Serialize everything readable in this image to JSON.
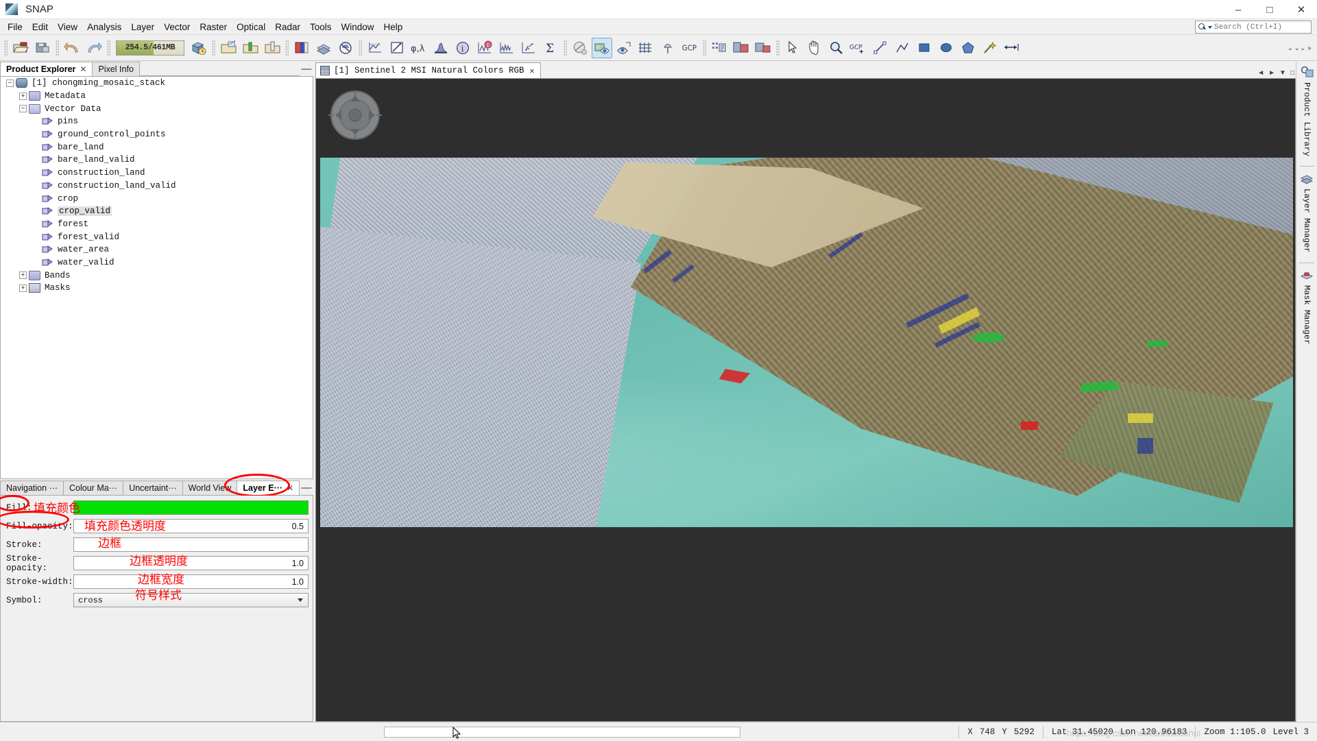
{
  "window": {
    "title": "SNAP",
    "app_icon": "snap-logo-icon",
    "minimize": "–",
    "maximize": "□",
    "close": "✕"
  },
  "menubar": {
    "items": [
      {
        "label": "File"
      },
      {
        "label": "Edit"
      },
      {
        "label": "View"
      },
      {
        "label": "Analysis"
      },
      {
        "label": "Layer"
      },
      {
        "label": "Vector"
      },
      {
        "label": "Raster"
      },
      {
        "label": "Optical"
      },
      {
        "label": "Radar"
      },
      {
        "label": "Tools"
      },
      {
        "label": "Window"
      },
      {
        "label": "Help"
      }
    ]
  },
  "search": {
    "placeholder": "Search (Ctrl+I)",
    "value": "",
    "icon": "search-icon"
  },
  "toolbar": {
    "memory_text": "254.5/461MB",
    "memory_percent": 55,
    "buttons": [
      {
        "name": "open-product-icon",
        "tooltip": "Open Product"
      },
      {
        "name": "save-product-icon",
        "tooltip": "Save Product"
      },
      {
        "name": "undo-icon",
        "tooltip": "Undo"
      },
      {
        "name": "redo-icon",
        "tooltip": "Redo"
      },
      {
        "name": "reset-memory-icon",
        "tooltip": "Reset Memory"
      },
      {
        "name": "open-rgb-image-icon",
        "tooltip": "Open RGB Image View"
      },
      {
        "name": "open-band-icon",
        "tooltip": "Open Image View"
      },
      {
        "name": "close-product-icon",
        "tooltip": "Close Product"
      },
      {
        "name": "colour-manipulation-icon",
        "tooltip": "Colour Manipulation"
      },
      {
        "name": "layer-manager-icon",
        "tooltip": "Layer Manager"
      },
      {
        "name": "mask-manager-icon",
        "tooltip": "Mask Manager"
      },
      {
        "name": "profile-plot-icon",
        "tooltip": "Profile Plot"
      },
      {
        "name": "geo-coding-icon",
        "tooltip": "Geo-Coding"
      },
      {
        "name": "phi-lambda-icon",
        "tooltip": "Geo-Coding Info"
      },
      {
        "name": "histogram-icon",
        "tooltip": "Histogram"
      },
      {
        "name": "information-icon",
        "tooltip": "Information"
      },
      {
        "name": "metadata-plot-icon",
        "tooltip": "Metadata Plot"
      },
      {
        "name": "spectrum-view-icon",
        "tooltip": "Optical Spectrum View"
      },
      {
        "name": "scatter-plot-icon",
        "tooltip": "Scatter Plot"
      },
      {
        "name": "statistics-icon",
        "tooltip": "Statistics"
      },
      {
        "name": "no-data-overlay-icon",
        "tooltip": "No-Data Overlay"
      },
      {
        "name": "mask-overlay-icon",
        "tooltip": "Mask Overlay"
      },
      {
        "name": "geometry-overlay-icon",
        "tooltip": "Geometry Overlay"
      },
      {
        "name": "graticule-overlay-icon",
        "tooltip": "Graticule Overlay"
      },
      {
        "name": "pin-overlay-icon",
        "tooltip": "Pin Overlay"
      },
      {
        "name": "gcp-overlay-icon",
        "tooltip": "GCP Overlay"
      },
      {
        "name": "pixel-info-icon",
        "tooltip": "Pixel Info"
      },
      {
        "name": "subset-icon",
        "tooltip": "Subset"
      },
      {
        "name": "band-maths-icon",
        "tooltip": "Band Maths"
      },
      {
        "name": "selection-tool-icon",
        "tooltip": "Selection"
      },
      {
        "name": "pan-tool-icon",
        "tooltip": "Panning"
      },
      {
        "name": "zoom-tool-icon",
        "tooltip": "Zooming"
      },
      {
        "name": "pin-tool-icon",
        "tooltip": "Pin placing"
      },
      {
        "name": "gcp-tool-icon",
        "tooltip": "GCP placing"
      },
      {
        "name": "line-tool-icon",
        "tooltip": "Line drawing"
      },
      {
        "name": "polyline-tool-icon",
        "tooltip": "Polyline drawing"
      },
      {
        "name": "rectangle-tool-icon",
        "tooltip": "Rectangle drawing"
      },
      {
        "name": "ellipse-tool-icon",
        "tooltip": "Ellipse drawing"
      },
      {
        "name": "polygon-tool-icon",
        "tooltip": "Polygon drawing"
      },
      {
        "name": "magic-wand-icon",
        "tooltip": "Magic Wand"
      },
      {
        "name": "range-finder-icon",
        "tooltip": "Range Finder"
      }
    ]
  },
  "left_panel": {
    "tabs": [
      {
        "label": "Product Explorer",
        "selected": true,
        "closable": true
      },
      {
        "label": "Pixel Info",
        "selected": false,
        "closable": false
      }
    ],
    "minimize_glyph": "—",
    "tree": [
      {
        "label": "[1] chongming_mosaic_stack",
        "indent": 0,
        "expander": "−",
        "icon": "product-icon",
        "selected": false
      },
      {
        "label": "Metadata",
        "indent": 1,
        "expander": "+",
        "icon": "folder-icon",
        "selected": false
      },
      {
        "label": "Vector Data",
        "indent": 1,
        "expander": "−",
        "icon": "folder-open-icon",
        "selected": false
      },
      {
        "label": "pins",
        "indent": 2,
        "expander": "",
        "icon": "vector-node-icon",
        "selected": false
      },
      {
        "label": "ground_control_points",
        "indent": 2,
        "expander": "",
        "icon": "vector-node-icon",
        "selected": false
      },
      {
        "label": "bare_land",
        "indent": 2,
        "expander": "",
        "icon": "vector-node-icon",
        "selected": false
      },
      {
        "label": "bare_land_valid",
        "indent": 2,
        "expander": "",
        "icon": "vector-node-icon",
        "selected": false
      },
      {
        "label": "construction_land",
        "indent": 2,
        "expander": "",
        "icon": "vector-node-icon",
        "selected": false
      },
      {
        "label": "construction_land_valid",
        "indent": 2,
        "expander": "",
        "icon": "vector-node-icon",
        "selected": false
      },
      {
        "label": "crop",
        "indent": 2,
        "expander": "",
        "icon": "vector-node-icon",
        "selected": false
      },
      {
        "label": "crop_valid",
        "indent": 2,
        "expander": "",
        "icon": "vector-node-icon",
        "selected": true
      },
      {
        "label": "forest",
        "indent": 2,
        "expander": "",
        "icon": "vector-node-icon",
        "selected": false
      },
      {
        "label": "forest_valid",
        "indent": 2,
        "expander": "",
        "icon": "vector-node-icon",
        "selected": false
      },
      {
        "label": "water_area",
        "indent": 2,
        "expander": "",
        "icon": "vector-node-icon",
        "selected": false
      },
      {
        "label": "water_valid",
        "indent": 2,
        "expander": "",
        "icon": "vector-node-icon",
        "selected": false
      },
      {
        "label": "Bands",
        "indent": 1,
        "expander": "+",
        "icon": "folder-icon",
        "selected": false
      },
      {
        "label": "Masks",
        "indent": 1,
        "expander": "+",
        "icon": "mask-folder-icon",
        "selected": false
      }
    ]
  },
  "bottom_panel": {
    "tabs": [
      {
        "label": "Navigation ···",
        "selected": false,
        "closable": false
      },
      {
        "label": "Colour Ma···",
        "selected": false,
        "closable": false
      },
      {
        "label": "Uncertaint···",
        "selected": false,
        "closable": false
      },
      {
        "label": "World View",
        "selected": false,
        "closable": false
      },
      {
        "label": "Layer E···",
        "selected": true,
        "closable": true
      }
    ],
    "minimize_glyph": "—",
    "layer_editor": {
      "fields": [
        {
          "label": "Fill:",
          "type": "color",
          "value": "",
          "color": "#00e000",
          "annotation": "填充颜色"
        },
        {
          "label": "Fill-opacity:",
          "type": "number",
          "value": "0.5",
          "annotation": "填充颜色透明度"
        },
        {
          "label": "Stroke:",
          "type": "color",
          "value": "",
          "annotation": "边框"
        },
        {
          "label": "Stroke-opacity:",
          "type": "number",
          "value": "1.0",
          "annotation": "边框透明度"
        },
        {
          "label": "Stroke-width:",
          "type": "number",
          "value": "1.0",
          "annotation": "边框宽度"
        },
        {
          "label": "Symbol:",
          "type": "select",
          "value": "cross",
          "annotation": "符号样式"
        }
      ]
    }
  },
  "image_view": {
    "tab_label": "[1] Sentinel 2 MSI Natural Colors RGB",
    "tab_icon": "raster-image-icon",
    "tab_close": "✕",
    "nav_controls": [
      "◄",
      "►",
      "▼",
      "□"
    ],
    "compass_icon": "pan-compass-icon"
  },
  "right_dock": {
    "items": [
      {
        "label": "Product Library",
        "icon": "product-library-icon"
      },
      {
        "label": "Layer Manager",
        "icon": "layer-manager-icon"
      },
      {
        "label": "Mask Manager",
        "icon": "mask-manager-icon"
      }
    ]
  },
  "statusbar": {
    "x_label": "X",
    "x_value": "748",
    "y_label": "Y",
    "y_value": "5292",
    "lat": "Lat 31.45020",
    "lon": "Lon 120.96183",
    "zoom": "Zoom 1:105.0",
    "level": "Level 3",
    "watermark": "https://blog.csdn.net/lidahuilidahui"
  },
  "colors": {
    "fill_green": "#00e000",
    "annotation_red": "#ff0000",
    "selection_blue": "#cfe3f5",
    "water_teal": "#6fc3b4"
  }
}
